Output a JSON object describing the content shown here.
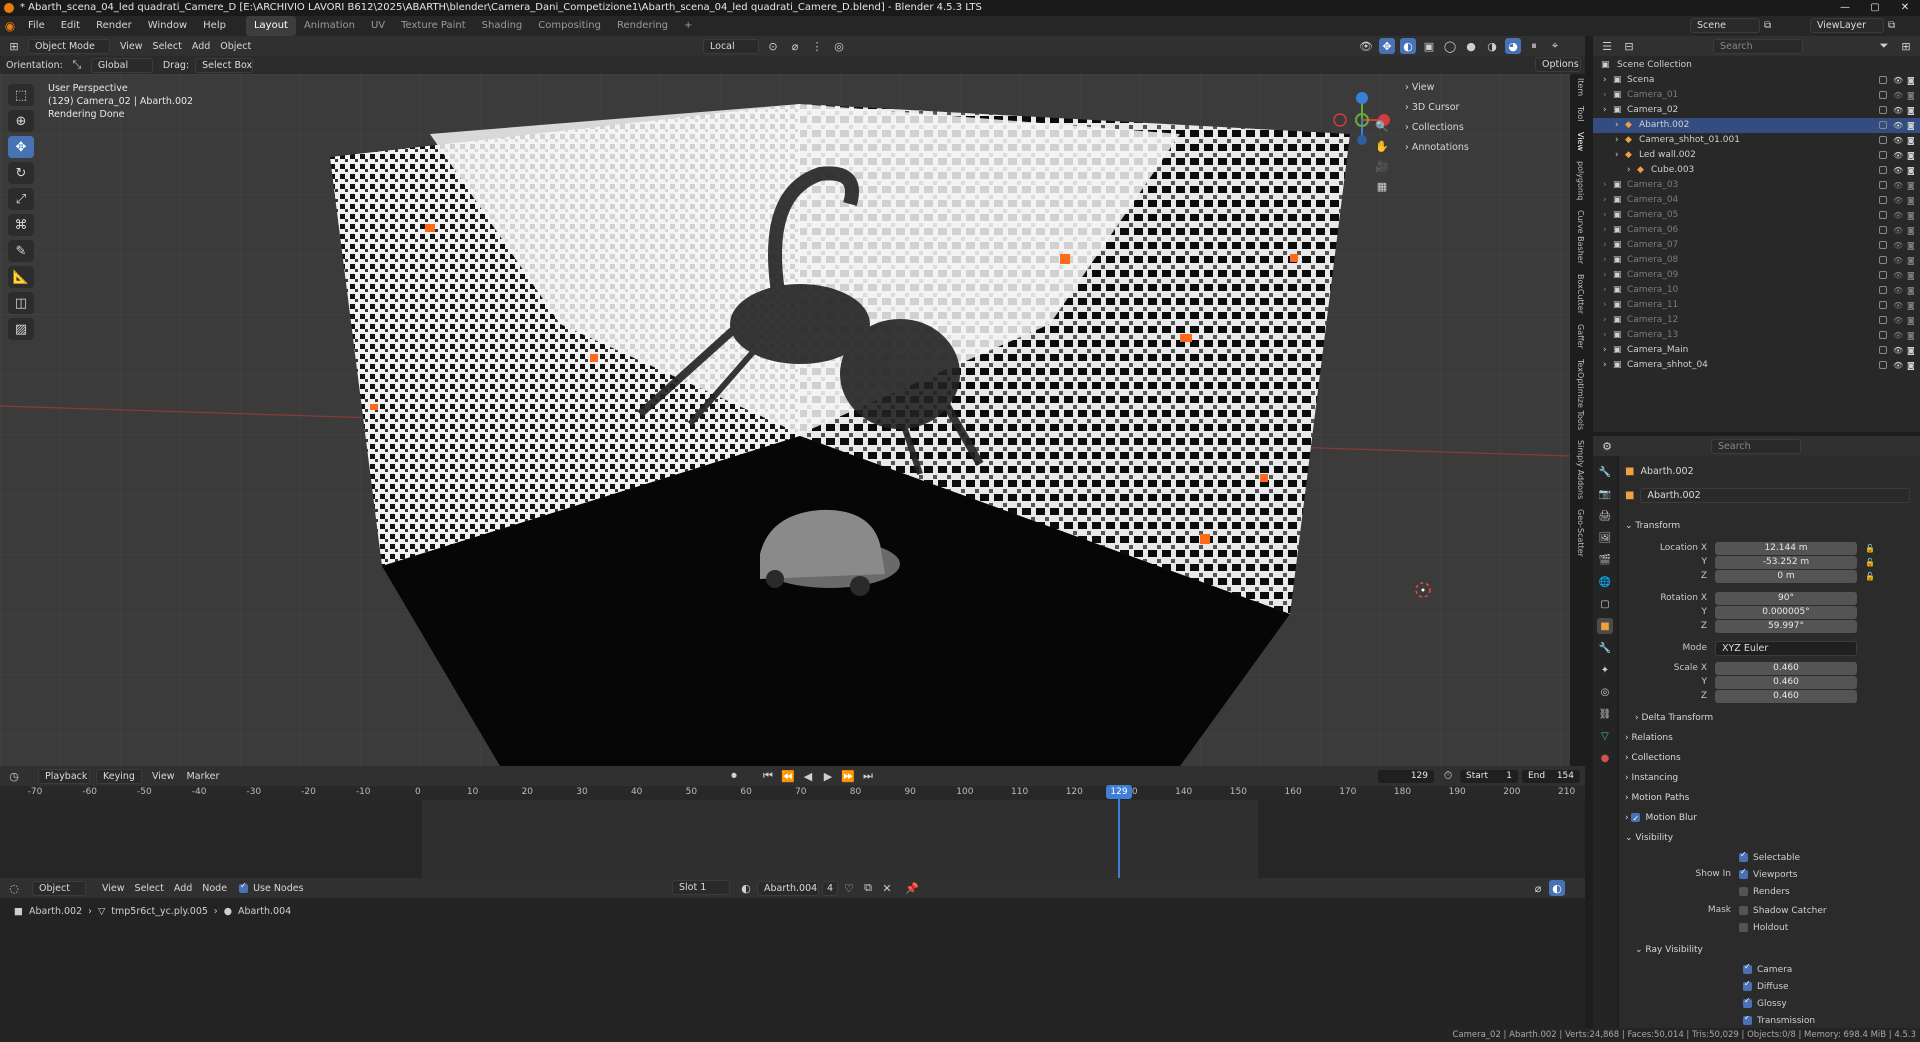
{
  "window": {
    "title": "* Abarth_scena_04_led quadrati_Camere_D [E:\\ARCHIVIO LAVORI B612\\2025\\ABARTH\\blender\\Camera_Dani_Competizione1\\Abarth_scena_04_led quadrati_Camere_D.blend] - Blender 4.5.3 LTS"
  },
  "menubar": {
    "menus": [
      "File",
      "Edit",
      "Render",
      "Window",
      "Help"
    ],
    "workspaces": [
      "Layout",
      "Animation",
      "UV",
      "Texture Paint",
      "Shading",
      "Compositing",
      "Rendering"
    ],
    "active_workspace": "Layout",
    "add_workspace": "+",
    "scene_label": "Scene",
    "viewlayer_label": "ViewLayer"
  },
  "viewport_header": {
    "mode": "Object Mode",
    "menus": [
      "View",
      "Select",
      "Add",
      "Object"
    ],
    "transform_space": "Local",
    "orientation_label": "Orientation:",
    "orientation_value": "Global",
    "drag_label": "Drag:",
    "drag_value": "Select Box",
    "options_label": "Options"
  },
  "viewport": {
    "perspective": "User Perspective",
    "object_line": "(129) Camera_02 | Abarth.002",
    "status": "Rendering Done"
  },
  "npanel": {
    "sections": [
      "View",
      "3D Cursor",
      "Collections",
      "Annotations"
    ],
    "tabs": [
      "Item",
      "Tool",
      "View",
      "polygoniq",
      "Curve Basher",
      "BoxCutter",
      "Gaffer",
      "TexOptimize Tools",
      "Simply Addons",
      "Geo-Scatter"
    ]
  },
  "outliner": {
    "search_placeholder": "Search",
    "root": "Scene Collection",
    "rows": [
      {
        "label": "Scena",
        "indent": 1,
        "dim": false
      },
      {
        "label": "Camera_01",
        "indent": 1,
        "dim": true
      },
      {
        "label": "Camera_02",
        "indent": 1,
        "dim": false
      },
      {
        "label": "Abarth.002",
        "indent": 2,
        "dim": false
      },
      {
        "label": "Camera_shhot_01.001",
        "indent": 2,
        "dim": false
      },
      {
        "label": "Led wall.002",
        "indent": 2,
        "dim": false
      },
      {
        "label": "Cube.003",
        "indent": 3,
        "dim": false
      },
      {
        "label": "Camera_03",
        "indent": 1,
        "dim": true
      },
      {
        "label": "Camera_04",
        "indent": 1,
        "dim": true
      },
      {
        "label": "Camera_05",
        "indent": 1,
        "dim": true
      },
      {
        "label": "Camera_06",
        "indent": 1,
        "dim": true
      },
      {
        "label": "Camera_07",
        "indent": 1,
        "dim": true
      },
      {
        "label": "Camera_08",
        "indent": 1,
        "dim": true
      },
      {
        "label": "Camera_09",
        "indent": 1,
        "dim": true
      },
      {
        "label": "Camera_10",
        "indent": 1,
        "dim": true
      },
      {
        "label": "Camera_11",
        "indent": 1,
        "dim": true
      },
      {
        "label": "Camera_12",
        "indent": 1,
        "dim": true
      },
      {
        "label": "Camera_13",
        "indent": 1,
        "dim": true
      },
      {
        "label": "Camera_Main",
        "indent": 1,
        "dim": false
      },
      {
        "label": "Camera_shhot_04",
        "indent": 1,
        "dim": false
      }
    ]
  },
  "properties": {
    "search_placeholder": "Search",
    "object_name": "Abarth.002",
    "datablock_name": "Abarth.002",
    "transform_label": "Transform",
    "location_label": "Location X",
    "location": [
      "12.144 m",
      "-53.252 m",
      "0 m"
    ],
    "rotation_label": "Rotation X",
    "rotation": [
      "90°",
      "0.000005°",
      "59.997°"
    ],
    "mode_label": "Mode",
    "mode_value": "XYZ Euler",
    "scale_label": "Scale X",
    "scale": [
      "0.460",
      "0.460",
      "0.460"
    ],
    "axis_y": "Y",
    "axis_z": "Z",
    "sections": [
      "Delta Transform",
      "Relations",
      "Collections",
      "Instancing",
      "Motion Paths",
      "Motion Blur"
    ],
    "visibility_label": "Visibility",
    "selectable_label": "Selectable",
    "show_in_label": "Show In",
    "viewports_label": "Viewports",
    "renders_label": "Renders",
    "mask_label": "Mask",
    "shadow_catcher_label": "Shadow Catcher",
    "holdout_label": "Holdout",
    "ray_visibility_label": "Ray Visibility",
    "camera_label": "Camera",
    "diffuse_label": "Diffuse",
    "glossy_label": "Glossy",
    "transmission_label": "Transmission"
  },
  "timeline": {
    "menus": [
      "Playback",
      "Keying",
      "View",
      "Marker"
    ],
    "current_frame": "129",
    "start_label": "Start",
    "start_value": "1",
    "end_label": "End",
    "end_value": "154",
    "ticks": [
      "-70",
      "-60",
      "-50",
      "-40",
      "-30",
      "-20",
      "-10",
      "0",
      "10",
      "20",
      "30",
      "40",
      "50",
      "60",
      "70",
      "80",
      "90",
      "100",
      "110",
      "120",
      "130",
      "140",
      "150",
      "160",
      "170",
      "180",
      "190",
      "200",
      "210"
    ]
  },
  "shader_editor": {
    "mode": "Object",
    "menus": [
      "View",
      "Select",
      "Add",
      "Node"
    ],
    "use_nodes_label": "Use Nodes",
    "slot": "Slot 1",
    "material": "Abarth.004",
    "users": "4",
    "breadcrumb": [
      "Abarth.002",
      "tmp5r6ct_yc.ply.005",
      "Abarth.004"
    ]
  },
  "statusbar": {
    "text": "Camera_02 | Abarth.002 | Verts:24,868 | Faces:50,014 | Tris:50,029 | Objects:0/8 | Memory: 698.4 MiB | 4.5.3"
  },
  "colors": {
    "accent": "#4772b3",
    "frame_marker": "#3f7fd6",
    "led_orange": "#ff6a1a"
  }
}
